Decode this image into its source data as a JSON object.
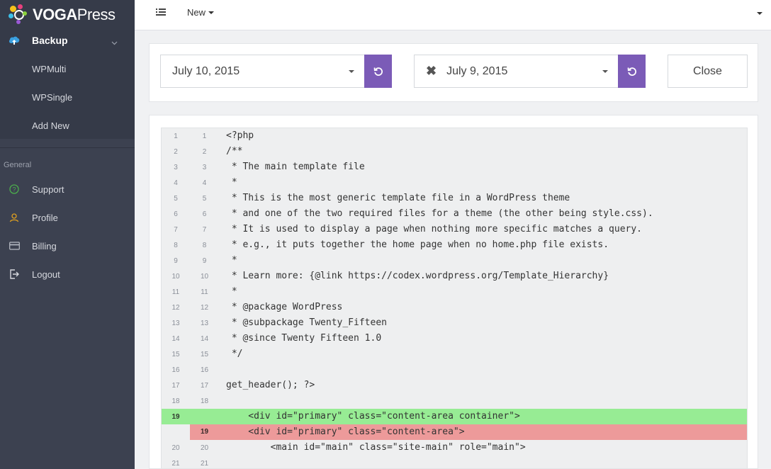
{
  "brand": {
    "name_bold": "VOGA",
    "name_light": "Press"
  },
  "sidebar": {
    "backup": {
      "label": "Backup",
      "items": [
        "WPMulti",
        "WPSingle",
        "Add New"
      ]
    },
    "section_label": "General",
    "nav": [
      {
        "label": "Support",
        "icon": "help-circle-icon"
      },
      {
        "label": "Profile",
        "icon": "user-icon"
      },
      {
        "label": "Billing",
        "icon": "credit-card-icon"
      },
      {
        "label": "Logout",
        "icon": "logout-icon"
      }
    ]
  },
  "topbar": {
    "new_label": "New"
  },
  "compare": {
    "left_date": "July 10, 2015",
    "right_date": "July 9, 2015",
    "close_label": "Close"
  },
  "colors": {
    "accent": "#7b5bb7",
    "added": "#97ec94",
    "removed": "#ed9a9a",
    "sidebar": "#3c4150"
  },
  "diff": [
    {
      "l": "1",
      "r": "1",
      "code": "<?php",
      "type": "ctx"
    },
    {
      "l": "2",
      "r": "2",
      "code": "/**",
      "type": "ctx"
    },
    {
      "l": "3",
      "r": "3",
      "code": " * The main template file",
      "type": "ctx"
    },
    {
      "l": "4",
      "r": "4",
      "code": " *",
      "type": "ctx"
    },
    {
      "l": "5",
      "r": "5",
      "code": " * This is the most generic template file in a WordPress theme",
      "type": "ctx"
    },
    {
      "l": "6",
      "r": "6",
      "code": " * and one of the two required files for a theme (the other being style.css).",
      "type": "ctx"
    },
    {
      "l": "7",
      "r": "7",
      "code": " * It is used to display a page when nothing more specific matches a query.",
      "type": "ctx"
    },
    {
      "l": "8",
      "r": "8",
      "code": " * e.g., it puts together the home page when no home.php file exists.",
      "type": "ctx"
    },
    {
      "l": "9",
      "r": "9",
      "code": " *",
      "type": "ctx"
    },
    {
      "l": "10",
      "r": "10",
      "code": " * Learn more: {@link https://codex.wordpress.org/Template_Hierarchy}",
      "type": "ctx"
    },
    {
      "l": "11",
      "r": "11",
      "code": " *",
      "type": "ctx"
    },
    {
      "l": "12",
      "r": "12",
      "code": " * @package WordPress",
      "type": "ctx"
    },
    {
      "l": "13",
      "r": "13",
      "code": " * @subpackage Twenty_Fifteen",
      "type": "ctx"
    },
    {
      "l": "14",
      "r": "14",
      "code": " * @since Twenty Fifteen 1.0",
      "type": "ctx"
    },
    {
      "l": "15",
      "r": "15",
      "code": " */",
      "type": "ctx"
    },
    {
      "l": "16",
      "r": "16",
      "code": "",
      "type": "ctx"
    },
    {
      "l": "17",
      "r": "17",
      "code": "get_header(); ?>",
      "type": "ctx"
    },
    {
      "l": "18",
      "r": "18",
      "code": "",
      "type": "ctx"
    },
    {
      "l": "19",
      "r": "",
      "code": "    <div id=\"primary\" class=\"content-area container\">",
      "type": "add"
    },
    {
      "l": "",
      "r": "19",
      "code": "    <div id=\"primary\" class=\"content-area\">",
      "type": "del"
    },
    {
      "l": "20",
      "r": "20",
      "code": "        <main id=\"main\" class=\"site-main\" role=\"main\">",
      "type": "ctx"
    },
    {
      "l": "21",
      "r": "21",
      "code": "",
      "type": "ctx"
    }
  ]
}
